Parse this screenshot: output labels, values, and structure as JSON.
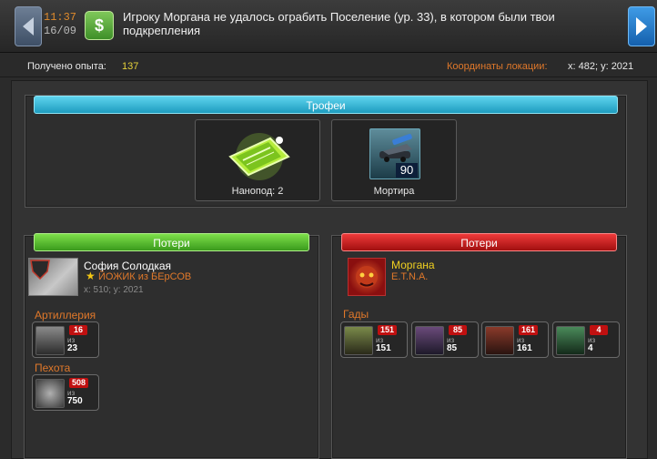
{
  "header": {
    "time": "11:37",
    "date": "16/09",
    "money_icon_symbol": "$",
    "message": "Игроку Моргана не удалось ограбить Поселение (ур. 33), в котором были твои подкрепления"
  },
  "info": {
    "xp_label": "Получено опыта:",
    "xp_value": "137",
    "coords_label": "Координаты локации:",
    "coords_value": "x: 482; y: 2021"
  },
  "trophies": {
    "title": "Трофеи",
    "items": [
      {
        "caption": "Нанопод: 2",
        "icon": "nanopod-icon"
      },
      {
        "caption": "Мортира",
        "count": "90",
        "icon": "mortar-icon"
      }
    ]
  },
  "left_losses": {
    "title": "Потери",
    "player": {
      "name": "София Солодкая",
      "alliance": "ЙОЖИК из БЕрСОВ",
      "coords": "x: 510; y: 2021"
    },
    "categories": [
      {
        "label": "Артиллерия",
        "units": [
          {
            "lost": "16",
            "of": "из",
            "total": "23"
          }
        ]
      },
      {
        "label": "Пехота",
        "units": [
          {
            "lost": "508",
            "of": "из",
            "total": "750"
          }
        ]
      }
    ]
  },
  "right_losses": {
    "title": "Потери",
    "player": {
      "name": "Моргана",
      "alliance": "E.T.N.A."
    },
    "categories": [
      {
        "label": "Гады",
        "units": [
          {
            "lost": "151",
            "of": "из",
            "total": "151"
          },
          {
            "lost": "85",
            "of": "из",
            "total": "85"
          },
          {
            "lost": "161",
            "of": "из",
            "total": "161"
          },
          {
            "lost": "4",
            "of": "из",
            "total": "4"
          }
        ]
      }
    ]
  },
  "colors": {
    "accent_orange": "#e0782a",
    "xp_yellow": "#e6d23a",
    "title_blue": "#1e9cbf",
    "title_green": "#3a9a1c",
    "title_red": "#a10f0f",
    "badge_red": "#c01010"
  }
}
